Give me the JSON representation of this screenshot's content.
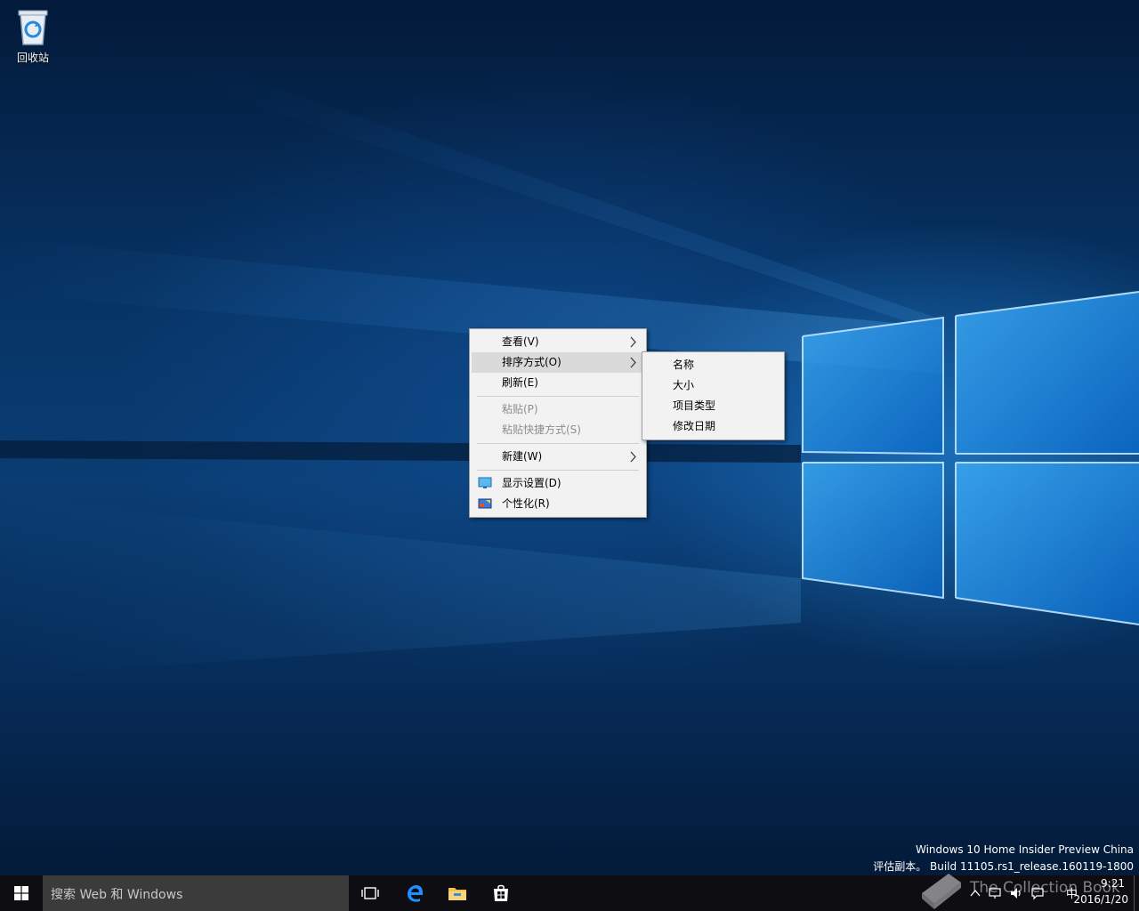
{
  "desktop": {
    "icons": [
      {
        "label": "回收站",
        "icon": "recycle-bin-icon"
      }
    ]
  },
  "context_menu": {
    "items": [
      {
        "label": "查看(V)",
        "submenu": true
      },
      {
        "label": "排序方式(O)",
        "submenu": true,
        "hover": true
      },
      {
        "label": "刷新(E)"
      },
      {
        "label": "粘贴(P)",
        "disabled": true
      },
      {
        "label": "粘贴快捷方式(S)",
        "disabled": true
      },
      {
        "label": "新建(W)",
        "submenu": true
      },
      {
        "label": "显示设置(D)",
        "icon": "display-settings-icon"
      },
      {
        "label": "个性化(R)",
        "icon": "personalize-icon"
      }
    ]
  },
  "sort_submenu": {
    "items": [
      "名称",
      "大小",
      "项目类型",
      "修改日期"
    ]
  },
  "watermark": {
    "line1": "Windows 10 Home Insider Preview China",
    "line2": "评估副本。 Build 11105.rs1_release.160119-1800"
  },
  "taskbar": {
    "search_placeholder": "搜索 Web 和 Windows",
    "pinned": [
      "task-view-icon",
      "edge-icon",
      "file-explorer-icon",
      "store-icon"
    ],
    "tray": {
      "ime": "中",
      "time": "9:21",
      "date": "2016/1/20"
    }
  },
  "overlay": {
    "book_text": "The Collection Book"
  },
  "colors": {
    "accent": "#0078d7",
    "taskbar": "#0d0d12",
    "menu_bg": "#f2f2f2",
    "menu_hover": "#dadada"
  }
}
